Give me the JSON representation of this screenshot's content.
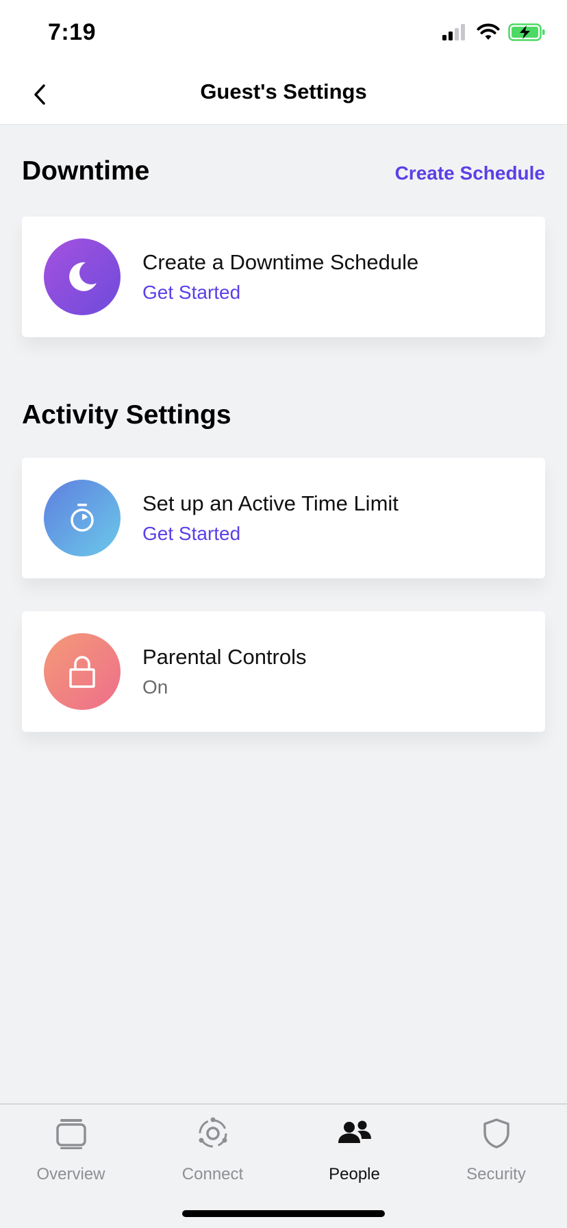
{
  "status_bar": {
    "time": "7:19"
  },
  "nav": {
    "title": "Guest's Settings"
  },
  "downtime": {
    "title": "Downtime",
    "action_label": "Create Schedule",
    "card": {
      "title": "Create a Downtime Schedule",
      "subtitle": "Get Started",
      "icon": "moon-icon"
    }
  },
  "activity": {
    "title": "Activity Settings",
    "cards": [
      {
        "title": "Set up an Active Time Limit",
        "subtitle": "Get Started",
        "icon": "stopwatch-icon"
      },
      {
        "title": "Parental Controls",
        "subtitle": "On",
        "icon": "lock-icon"
      }
    ]
  },
  "tab_bar": {
    "tabs": [
      {
        "label": "Overview",
        "icon": "overview-icon",
        "active": false
      },
      {
        "label": "Connect",
        "icon": "connect-icon",
        "active": false
      },
      {
        "label": "People",
        "icon": "people-icon",
        "active": true
      },
      {
        "label": "Security",
        "icon": "shield-icon",
        "active": false
      }
    ]
  },
  "colors": {
    "accent": "#5b3fe6",
    "background": "#f1f2f4",
    "moon_gradient": [
      "#a551de",
      "#6e4bdc"
    ],
    "stopwatch_gradient": [
      "#5e7fdf",
      "#6cc9ea"
    ],
    "lock_gradient": [
      "#f39a78",
      "#ee6e8a"
    ]
  }
}
